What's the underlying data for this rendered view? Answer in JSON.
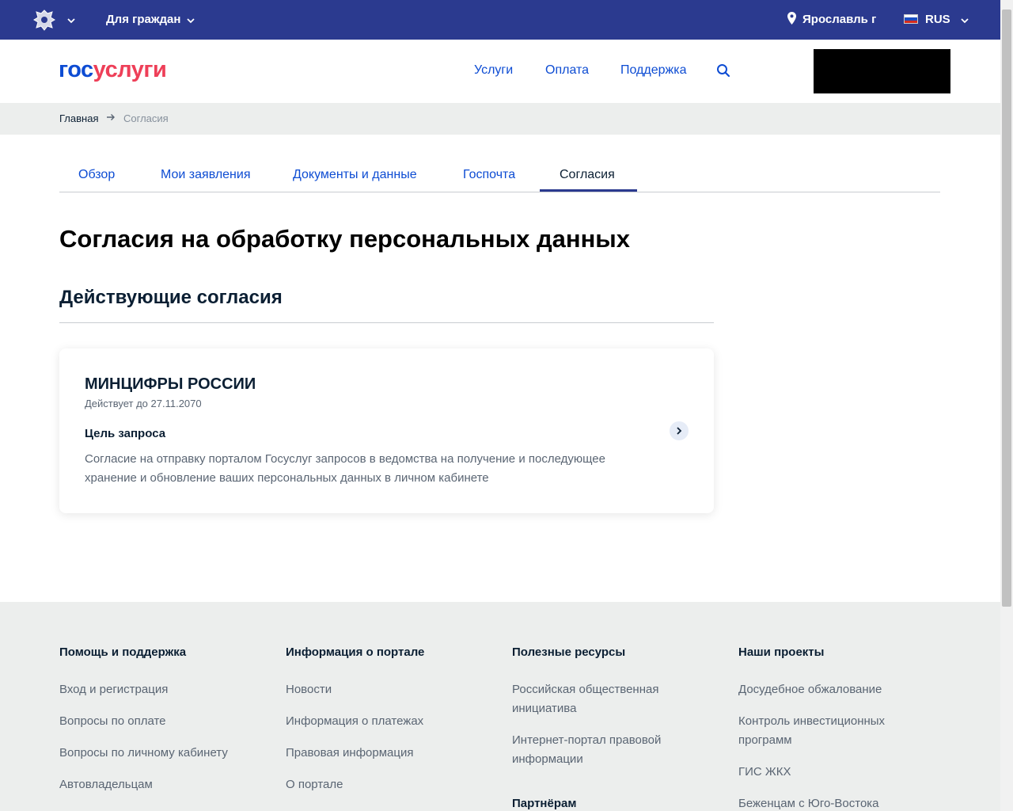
{
  "topbar": {
    "emblem_icon": "russian-emblem-icon",
    "audience": "Для граждан",
    "city": "Ярославль г",
    "language": "RUS",
    "bg_color": "#2b3a8f"
  },
  "header": {
    "logo_gos": "гос",
    "logo_uslugi": "услуги",
    "nav": [
      "Услуги",
      "Оплата",
      "Поддержка"
    ],
    "accent_color": "#0d4cd3"
  },
  "breadcrumbs": {
    "home": "Главная",
    "current": "Согласия"
  },
  "tabs": [
    {
      "label": "Обзор"
    },
    {
      "label": "Мои заявления"
    },
    {
      "label": "Документы и данные"
    },
    {
      "label": "Госпочта"
    },
    {
      "label": "Согласия",
      "active": true
    }
  ],
  "page": {
    "title": "Согласия на обработку персональных данных",
    "section": "Действующие согласия"
  },
  "consent_card": {
    "organization": "МИНЦИФРЫ РОССИИ",
    "valid_until": "Действует до 27.11.2070",
    "purpose_heading": "Цель запроса",
    "purpose_text": "Согласие на отправку порталом Госуслуг запросов в ведомства на получение и последующее хранение и обновление ваших персональных данных в личном кабинете"
  },
  "footer": {
    "columns": [
      {
        "title": "Помощь и поддержка",
        "links": [
          "Вход и регистрация",
          "Вопросы по оплате",
          "Вопросы по личному кабинету",
          "Автовладельцам"
        ]
      },
      {
        "title": "Информация о портале",
        "links": [
          "Новости",
          "Информация о платежах",
          "Правовая информация",
          "О портале"
        ]
      },
      {
        "title": "Полезные ресурсы",
        "links": [
          "Российская общественная инициатива",
          "Интернет-портал правовой информации"
        ],
        "subtitle": "Партнёрам"
      },
      {
        "title": "Наши проекты",
        "links": [
          "Досудебное обжалование",
          "Контроль инвестиционных программ",
          "ГИС ЖКХ",
          "Беженцам с Юго-Востока"
        ]
      }
    ]
  }
}
